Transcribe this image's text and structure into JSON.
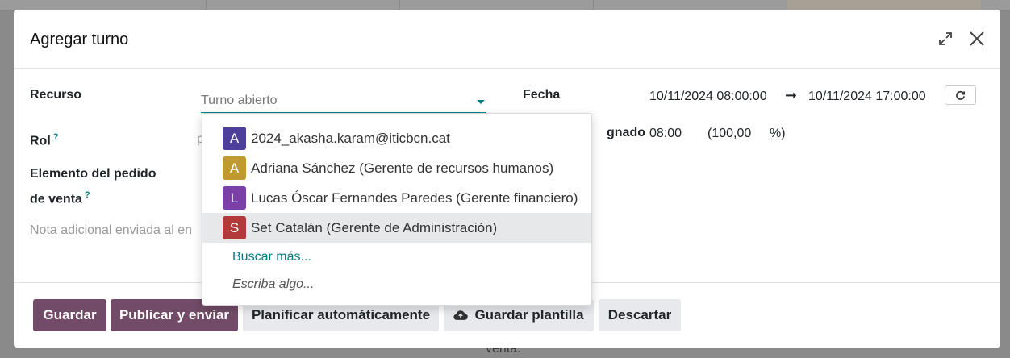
{
  "modal": {
    "title": "Agregar turno"
  },
  "form": {
    "resource_label": "Recurso",
    "resource_placeholder": "Turno abierto",
    "role_label": "Rol",
    "role_help": "?",
    "role_value_partial": "p",
    "sale_line_label_1": "Elemento del pedido",
    "sale_line_label_2": "de venta",
    "sale_line_help": "?",
    "note_placeholder_partial": "Nota adicional enviada al en",
    "date_label": "Fecha",
    "date_start": "10/11/2024 08:00:00",
    "date_arrow": "➞",
    "date_end": "10/11/2024 17:00:00",
    "allocated_label_partial": "gnado",
    "allocated_hours": "08:00",
    "allocated_percent": "(100,00",
    "allocated_percent_unit": "%)"
  },
  "dropdown": {
    "options": [
      {
        "initial": "A",
        "color": "#4e3f9a",
        "label": "2024_akasha.karam@iticbcn.cat"
      },
      {
        "initial": "A",
        "color": "#c09a2e",
        "label": "Adriana Sánchez (Gerente de recursos humanos)"
      },
      {
        "initial": "L",
        "color": "#7b3fa8",
        "label": "Lucas Óscar Fernandes Paredes (Gerente financiero)"
      },
      {
        "initial": "S",
        "color": "#b23a3a",
        "label": "Set Catalán (Gerente de Administración)"
      }
    ],
    "search_more": "Buscar más...",
    "type_hint": "Escriba algo..."
  },
  "footer": {
    "save": "Guardar",
    "publish": "Publicar y enviar",
    "auto_plan": "Planificar automáticamente",
    "save_template": "Guardar plantilla",
    "discard": "Descartar"
  },
  "background": {
    "bottom_text": "venta."
  },
  "colors": {
    "primary": "#714b67",
    "accent": "#017e84"
  }
}
